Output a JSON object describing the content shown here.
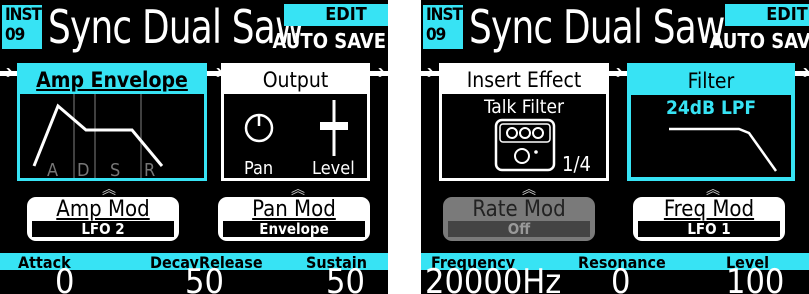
{
  "screens": [
    {
      "instrument": {
        "line1": "INST",
        "line2": "09",
        "name": "Sync Dual Saw"
      },
      "edit_label": "EDIT",
      "auto_save_label": "AUTO SAVE",
      "cards": [
        {
          "title": "Amp Envelope",
          "letters": [
            "A",
            "D",
            "S",
            "R"
          ]
        },
        {
          "title": "Output",
          "labels": [
            "Pan",
            "Level"
          ]
        }
      ],
      "mods": [
        {
          "title": "Amp Mod",
          "value": "LFO 2"
        },
        {
          "title": "Pan Mod",
          "value": "Envelope"
        }
      ],
      "params": [
        {
          "label": "Attack",
          "value": "0"
        },
        {
          "label": "Decay",
          "value": ""
        },
        {
          "label": "Release",
          "value": "50"
        },
        {
          "label": "Sustain",
          "value": "50"
        }
      ]
    },
    {
      "instrument": {
        "line1": "INST",
        "line2": "09",
        "name": "Sync Dual Saw"
      },
      "edit_label": "EDIT",
      "auto_save_label": "AUTO SAVE",
      "cards": [
        {
          "title": "Insert Effect",
          "subtitle": "Talk Filter",
          "page": "1/4"
        },
        {
          "title": "Filter",
          "subtitle": "24dB LPF"
        }
      ],
      "mods": [
        {
          "title": "Rate Mod",
          "value": "Off"
        },
        {
          "title": "Freq Mod",
          "value": "LFO 1"
        }
      ],
      "params": [
        {
          "label": "Frequency",
          "value": "20000Hz"
        },
        {
          "label": "Resonance",
          "value": "0"
        },
        {
          "label": "Level",
          "value": "100"
        }
      ]
    }
  ],
  "colors": {
    "accent": "#37e3f4",
    "background": "#000000",
    "text": "#ffffff"
  }
}
